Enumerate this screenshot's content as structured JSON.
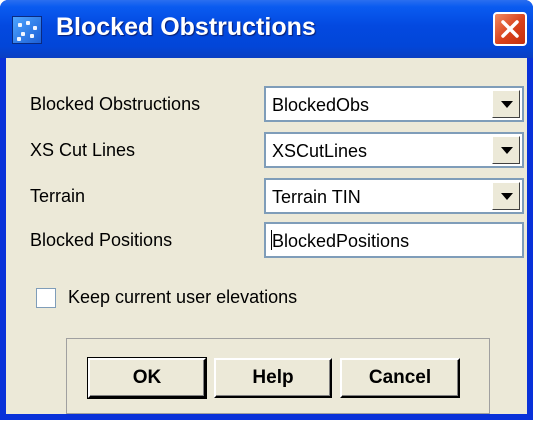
{
  "window": {
    "title": "Blocked Obstructions"
  },
  "form": {
    "blocked_obstructions": {
      "label": "Blocked Obstructions",
      "value": "BlockedObs"
    },
    "xs_cut_lines": {
      "label": "XS Cut Lines",
      "value": "XSCutLines"
    },
    "terrain": {
      "label": "Terrain",
      "value": "Terrain TIN"
    },
    "blocked_positions": {
      "label": "Blocked Positions",
      "value": "BlockedPositions"
    },
    "keep_elevations": {
      "label": "Keep current user elevations",
      "checked": false
    }
  },
  "buttons": {
    "ok": "OK",
    "help": "Help",
    "cancel": "Cancel"
  }
}
